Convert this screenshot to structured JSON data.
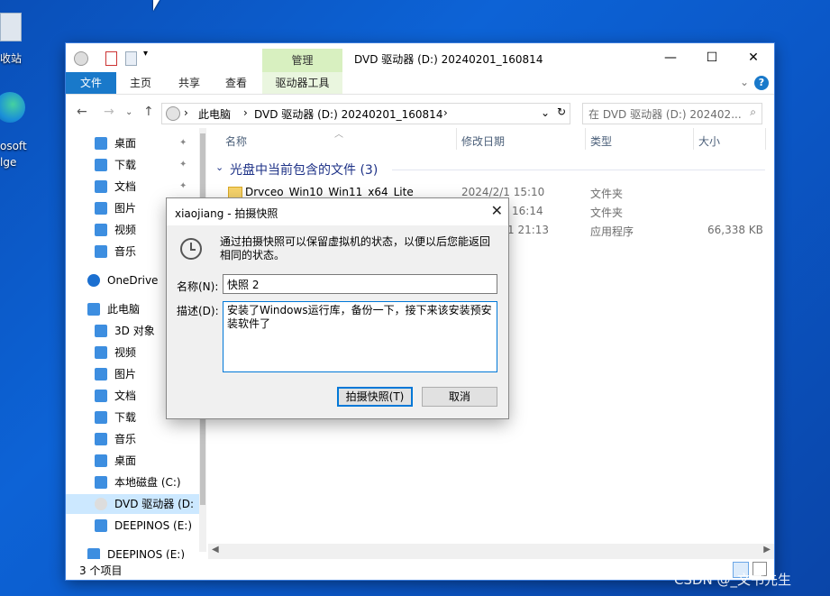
{
  "desktop": {
    "icon1_label": "收站",
    "icon2_label_line1": "osoft",
    "icon2_label_line2": "lge",
    "watermark": "CSDN @_文书先生"
  },
  "explorer": {
    "title": "DVD 驱动器 (D:) 20240201_160814",
    "context_tab_group": "管理",
    "tabs": [
      "文件",
      "主页",
      "共享",
      "查看",
      "驱动器工具"
    ],
    "address": {
      "crumbs": [
        "此电脑",
        "DVD 驱动器 (D:) 20240201_160814"
      ],
      "search_placeholder": "在 DVD 驱动器 (D:) 202402..."
    },
    "nav": [
      {
        "label": "桌面",
        "pinned": true
      },
      {
        "label": "下载",
        "pinned": true
      },
      {
        "label": "文档",
        "pinned": true
      },
      {
        "label": "图片",
        "pinned": true
      },
      {
        "label": "视频",
        "pinned": false
      },
      {
        "label": "音乐",
        "pinned": false
      },
      {
        "label": "OneDrive",
        "pinned": false
      },
      {
        "label": "此电脑",
        "pinned": false
      },
      {
        "label": "3D 对象",
        "pinned": false
      },
      {
        "label": "视频",
        "pinned": false
      },
      {
        "label": "图片",
        "pinned": false
      },
      {
        "label": "文档",
        "pinned": false
      },
      {
        "label": "下载",
        "pinned": false
      },
      {
        "label": "音乐",
        "pinned": false
      },
      {
        "label": "桌面",
        "pinned": false
      },
      {
        "label": "本地磁盘 (C:)",
        "pinned": false
      },
      {
        "label": "DVD 驱动器 (D:",
        "pinned": false
      },
      {
        "label": "DEEPINOS (E:)",
        "pinned": false
      },
      {
        "label": "DEEPINOS (E:)",
        "pinned": false
      }
    ],
    "columns": {
      "name": "名称",
      "date": "修改日期",
      "type": "类型",
      "size": "大小"
    },
    "group_header": "光盘中当前包含的文件 (3)",
    "files": [
      {
        "name": "Drvceo_Win10_Win11_x64_Lite",
        "date": "2024/2/1 15:10",
        "type": "文件夹",
        "size": ""
      },
      {
        "name": "",
        "date": "16:14",
        "type": "文件夹",
        "size": ""
      },
      {
        "name": "",
        "date": "1 21:13",
        "type": "应用程序",
        "size": "66,338 KB"
      }
    ],
    "status": "3 个项目"
  },
  "dialog": {
    "title": "xiaojiang - 拍摄快照",
    "message": "通过拍摄快照可以保留虚拟机的状态，以便以后您能返回相同的状态。",
    "name_label": "名称(N):",
    "name_value": "快照 2",
    "desc_label": "描述(D):",
    "desc_value": "安装了Windows运行库，备份一下，接下来该安装预安装软件了",
    "ok_button": "拍摄快照(T)",
    "cancel_button": "取消"
  },
  "colors": {
    "accent": "#1979ca",
    "manage_tab": "#d8f0c0",
    "selected": "#cce8ff",
    "desktop": "#0d63d6"
  }
}
